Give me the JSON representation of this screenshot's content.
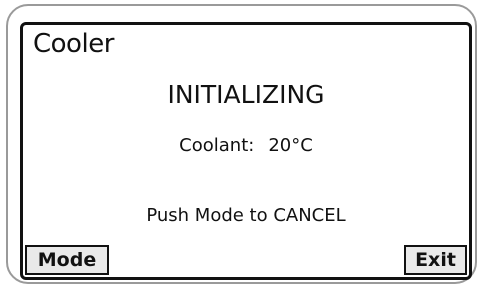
{
  "screen": {
    "title": "Cooler",
    "status": "INITIALIZING",
    "coolant_label": "Coolant:",
    "coolant_value": "20°C",
    "hint": "Push Mode to CANCEL"
  },
  "softkeys": {
    "left_label": "Mode",
    "right_label": "Exit"
  },
  "colors": {
    "screen_border": "#111111",
    "bezel": "#9a9a9a",
    "softkey_bg": "#e9e9e9"
  }
}
